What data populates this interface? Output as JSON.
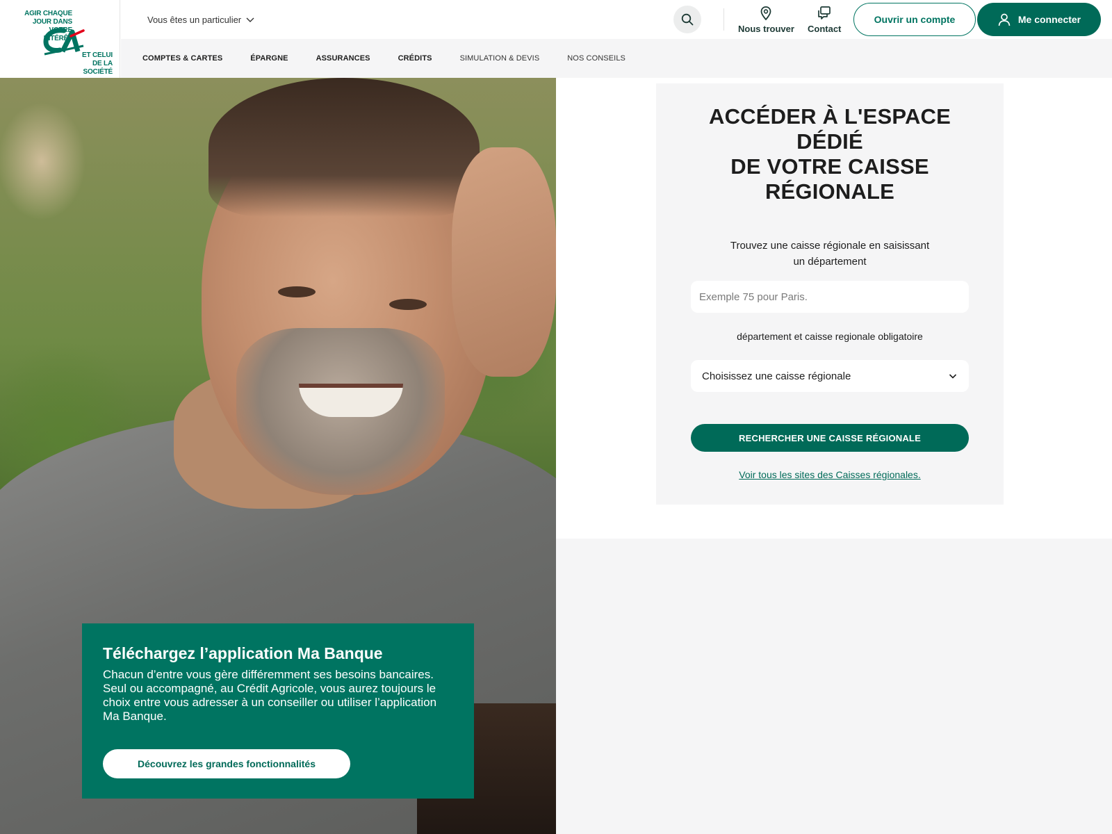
{
  "logo": {
    "tagline_top": "AGIR CHAQUE\nJOUR DANS VOTRE\nINTÉRÊT",
    "tagline_bottom": "ET CELUI\nDE LA SOCIÉTÉ",
    "mark": "CA"
  },
  "header": {
    "profile_switch": "Vous êtes un particulier",
    "nav": [
      "COMPTES & CARTES",
      "ÉPARGNE",
      "ASSURANCES",
      "CRÉDITS",
      "SIMULATION & DEVIS",
      "NOS CONSEILS"
    ],
    "find_label": "Nous trouver",
    "contact_label": "Contact",
    "open_account": "Ouvrir un compte",
    "login": "Me connecter"
  },
  "card": {
    "title": "ACCÉDER À L'ESPACE\nDÉDIÉ\nDE VOTRE CAISSE\nRÉGIONALE",
    "subtitle": "Trouvez une caisse régionale en saisissant\nun département",
    "input_placeholder": "Exemple 75 pour Paris.",
    "required_note": "département et caisse regionale obligatoire",
    "select_value": "Choisissez une caisse régionale",
    "search_button": "RECHERCHER UNE CAISSE RÉGIONALE",
    "all_sites_link": "Voir tous les sites des Caisses régionales."
  },
  "promo": {
    "title": "Téléchargez l’application Ma Banque",
    "text": "Chacun d’entre vous gère différemment ses besoins bancaires.\nSeul ou accompagné, au Crédit Agricole, vous aurez toujours le choix entre vous adresser à un conseiller ou utiliser l’application Ma Banque.",
    "button": "Découvrez les grandes fonctionnalités"
  },
  "colors": {
    "brand_green": "#007461",
    "button_green": "#006a58",
    "panel_grey": "#f5f5f6"
  },
  "icons": [
    "chevron-down-icon",
    "search-icon",
    "location-pin-icon",
    "chat-icon",
    "user-icon"
  ]
}
